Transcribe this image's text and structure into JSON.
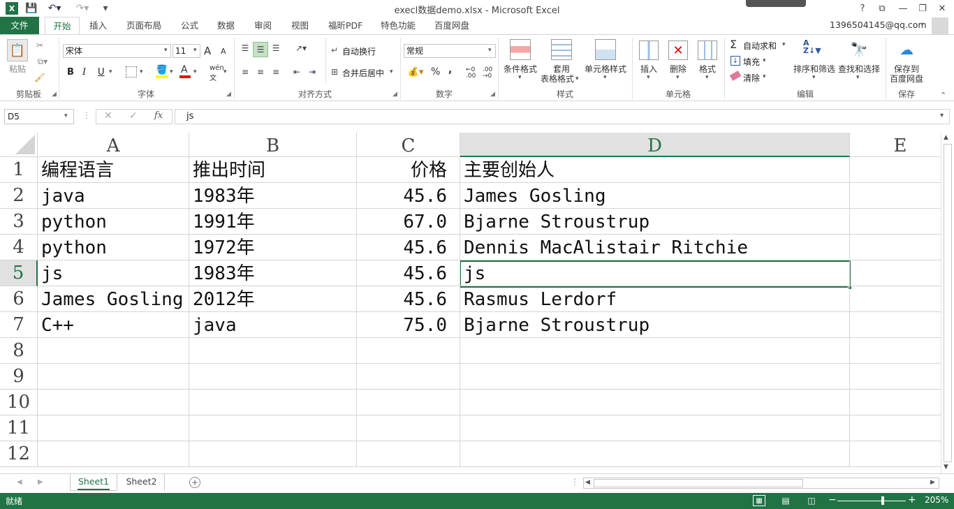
{
  "window": {
    "title": "execl数据demo.xlsx - Microsoft Excel"
  },
  "tabs": [
    "文件",
    "开始",
    "插入",
    "页面布局",
    "公式",
    "数据",
    "审阅",
    "视图",
    "福昕PDF",
    "特色功能",
    "百度网盘"
  ],
  "account": "1396504145@qq.com",
  "ribbon": {
    "clipboard": {
      "paste": "粘贴",
      "group": "剪贴板"
    },
    "font": {
      "name": "宋体",
      "size": "11",
      "group": "字体",
      "bold": "B",
      "italic": "I",
      "underline": "U",
      "grow": "A",
      "shrink": "A",
      "color_a": "A"
    },
    "align": {
      "wrap": "自动换行",
      "merge": "合并后居中",
      "group": "对齐方式"
    },
    "number": {
      "format": "常规",
      "percent": "%",
      "comma": ",",
      "group": "数字"
    },
    "styles": {
      "conditional": "条件格式",
      "table1": "套用",
      "table2": "表格格式",
      "cell": "单元格样式",
      "group": "样式"
    },
    "cells": {
      "insert": "插入",
      "delete": "删除",
      "format": "格式",
      "group": "单元格"
    },
    "editing": {
      "autosum": "自动求和",
      "fill": "填充",
      "clear": "清除",
      "sort": "排序和筛选",
      "find": "查找和选择",
      "group": "编辑"
    },
    "save": {
      "line1": "保存到",
      "line2": "百度网盘",
      "group": "保存"
    }
  },
  "formula_bar": {
    "name_box": "D5",
    "fx": "fx",
    "value": "js"
  },
  "columns": [
    "A",
    "B",
    "C",
    "D",
    "E"
  ],
  "rows": [
    "1",
    "2",
    "3",
    "4",
    "5",
    "6",
    "7",
    "8",
    "9",
    "10",
    "11",
    "12"
  ],
  "cells": [
    [
      "编程语言",
      "推出时间",
      "价格",
      "主要创始人"
    ],
    [
      "java",
      "1983年",
      "45.6",
      "James Gosling"
    ],
    [
      "python",
      "1991年",
      "67.0",
      "Bjarne Stroustrup"
    ],
    [
      "python",
      "1972年",
      "45.6",
      "Dennis MacAlistair Ritchie"
    ],
    [
      "js",
      "1983年",
      "45.6",
      "js"
    ],
    [
      "James Gosling",
      "2012年",
      "45.6",
      "Rasmus Lerdorf"
    ],
    [
      "C++",
      "java",
      "75.0",
      "Bjarne Stroustrup"
    ]
  ],
  "selected_cell": "D5",
  "sheets": [
    "Sheet1",
    "Sheet2"
  ],
  "status": {
    "ready": "就绪",
    "zoom": "205%"
  },
  "colors": {
    "accent": "#217346"
  }
}
